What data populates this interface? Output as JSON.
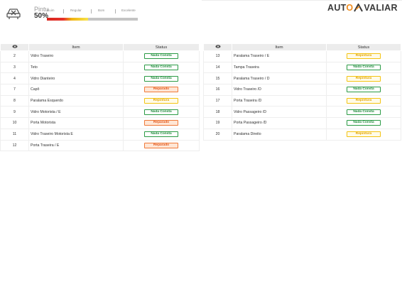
{
  "header": {
    "title": "Pintu",
    "percent": "50%",
    "scale_labels": [
      "Ruim",
      "Regular",
      "Bom",
      "Excelente"
    ],
    "scale_level": 0.45
  },
  "logo": {
    "part1": "AUT",
    "part1_o": "O",
    "part2": "VALIAR"
  },
  "columns": {
    "item": "Item",
    "status": "Status"
  },
  "left_rows": [
    {
      "n": "2",
      "item": "Vidro Traseiro",
      "status": "Nada Consta",
      "kind": "ok"
    },
    {
      "n": "3",
      "item": "Teto",
      "status": "Nada Consta",
      "kind": "ok"
    },
    {
      "n": "4",
      "item": "Vidro Dianteiro",
      "status": "Nada Consta",
      "kind": "ok"
    },
    {
      "n": "7",
      "item": "Capô",
      "status": "Reparado",
      "kind": "rep"
    },
    {
      "n": "8",
      "item": "Paralama Esquerdo",
      "status": "Repintura",
      "kind": "pin"
    },
    {
      "n": "9",
      "item": "Vidro Motorista / E",
      "status": "Nada Consta",
      "kind": "ok"
    },
    {
      "n": "10",
      "item": "Porta Motorista",
      "status": "Reparado",
      "kind": "rep"
    },
    {
      "n": "11",
      "item": "Vidro Traseiro Motorista E",
      "status": "Nada Consta",
      "kind": "ok"
    },
    {
      "n": "12",
      "item": "Porta Traseira / E",
      "status": "Reparado",
      "kind": "rep"
    }
  ],
  "right_rows": [
    {
      "n": "13",
      "item": "Paralama Traseiro / E",
      "status": "Repintura",
      "kind": "pin"
    },
    {
      "n": "14",
      "item": "Tampa Traseira",
      "status": "Nada Consta",
      "kind": "ok"
    },
    {
      "n": "15",
      "item": "Paralama Traseiro / D",
      "status": "Repintura",
      "kind": "pin"
    },
    {
      "n": "16",
      "item": "Vidro Traseiro /D",
      "status": "Nada Consta",
      "kind": "ok"
    },
    {
      "n": "17",
      "item": "Porta Traseira /D",
      "status": "Repintura",
      "kind": "pin"
    },
    {
      "n": "18",
      "item": "Vidro Passageiro /D",
      "status": "Nada Consta",
      "kind": "ok"
    },
    {
      "n": "19",
      "item": "Porta Passageiro /D",
      "status": "Nada Consta",
      "kind": "ok"
    },
    {
      "n": "20",
      "item": "Paralama Direito",
      "status": "Repintura",
      "kind": "pin"
    }
  ],
  "colors": {
    "ok": "#2a9a44",
    "reparado": "#ef7a3a",
    "repintura": "#f3c310",
    "brand_orange": "#f08c1e"
  },
  "icons": {
    "car": "car-inspection-icon",
    "eye": "eye-icon"
  }
}
